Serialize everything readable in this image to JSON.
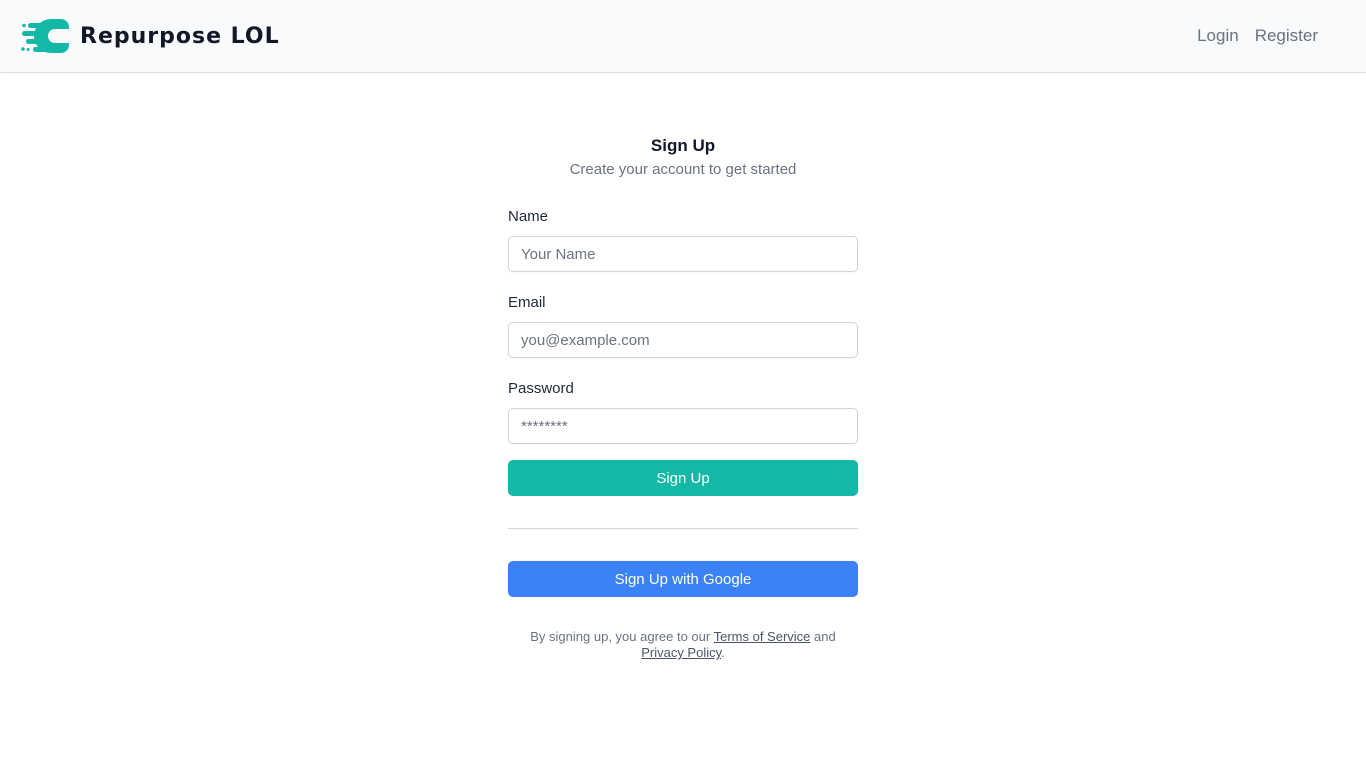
{
  "header": {
    "brand_name": "Repurpose LOL",
    "nav": {
      "login": "Login",
      "register": "Register"
    }
  },
  "form": {
    "title": "Sign Up",
    "subtitle": "Create your account to get started",
    "name": {
      "label": "Name",
      "placeholder": "Your Name",
      "value": ""
    },
    "email": {
      "label": "Email",
      "placeholder": "you@example.com",
      "value": ""
    },
    "password": {
      "label": "Password",
      "placeholder": "********",
      "value": ""
    },
    "submit_label": "Sign Up",
    "google_label": "Sign Up with Google",
    "legal": {
      "prefix": "By signing up, you agree to our ",
      "terms": "Terms of Service",
      "middle": " and ",
      "privacy": "Privacy Policy",
      "suffix": "."
    }
  },
  "colors": {
    "brand": "#14b8a6",
    "google_button": "#3b82f6",
    "header_bg": "#f9fafb"
  },
  "icons": {
    "logo": "speed-c-logo-icon"
  }
}
